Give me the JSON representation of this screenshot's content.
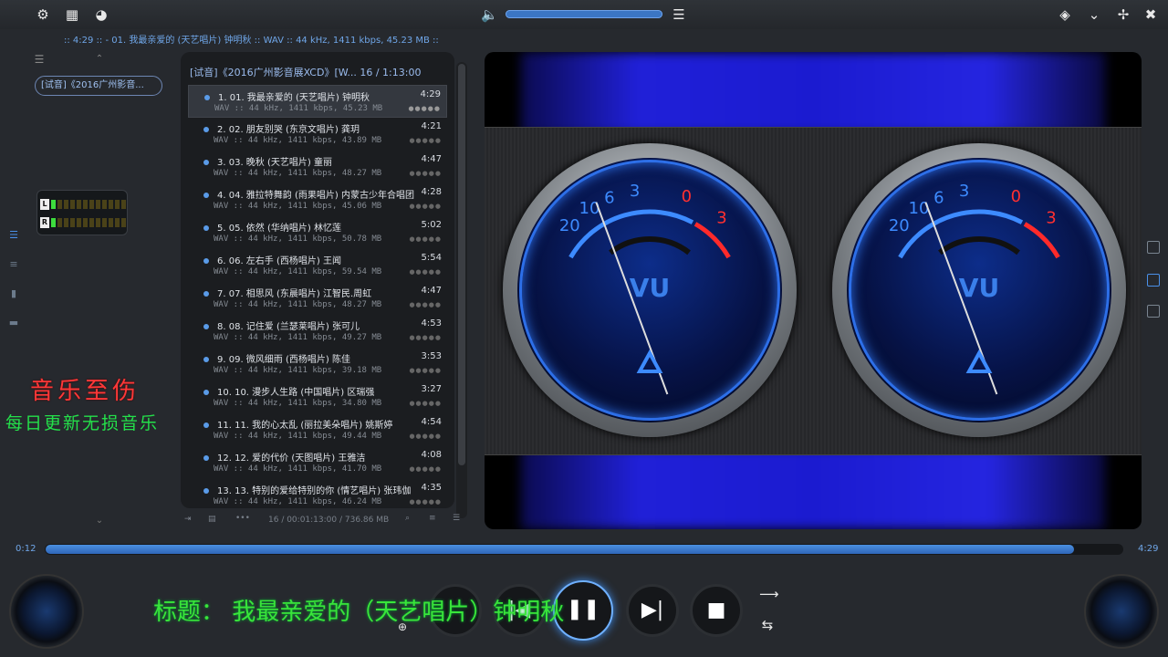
{
  "toolbar": {
    "settings_icon": "gear-icon",
    "layout_icon": "grid-icon",
    "theme_icon": "palette-icon",
    "volume_icon": "speaker-icon",
    "eq_icon": "sliders-icon",
    "volume_level": 0.98
  },
  "window": {
    "pin": "◈",
    "minimize": "⌄",
    "restore": "⌃",
    "close": "✖"
  },
  "nowplaying_line": ":: 4:29 :: - 01. 我最亲爱的 (天艺唱片) 钟明秋 :: WAV :: 44 kHz, 1411 kbps, 45.23 MB ::",
  "left": {
    "album_tag": "[试音]《2016广州影音...",
    "channel_l": "L",
    "channel_r": "R",
    "brand_title": "音乐至伤",
    "brand_sub": "每日更新无损音乐"
  },
  "playlist": {
    "header": "[试音]《2016广州影音展XCD》[W... 16 / 1:13:00",
    "tracks": [
      {
        "title": "1. 01. 我最亲爱的 (天艺唱片) 钟明秋",
        "dur": "4:29",
        "meta": "WAV :: 44 kHz, 1411 kbps, 45.23 MB"
      },
      {
        "title": "2. 02. 朋友别哭 (东京文唱片) 龚玥",
        "dur": "4:21",
        "meta": "WAV :: 44 kHz, 1411 kbps, 43.89 MB"
      },
      {
        "title": "3. 03. 晚秋 (天艺唱片) 童丽",
        "dur": "4:47",
        "meta": "WAV :: 44 kHz, 1411 kbps, 48.27 MB"
      },
      {
        "title": "4. 04. 雅拉特舞韵 (雨果唱片) 内蒙古少年合唱团",
        "dur": "4:28",
        "meta": "WAV :: 44 kHz, 1411 kbps, 45.06 MB"
      },
      {
        "title": "5. 05. 依然 (华纳唱片) 林忆莲",
        "dur": "5:02",
        "meta": "WAV :: 44 kHz, 1411 kbps, 50.78 MB"
      },
      {
        "title": "6. 06. 左右手 (西杨唱片) 王闻",
        "dur": "5:54",
        "meta": "WAV :: 44 kHz, 1411 kbps, 59.54 MB"
      },
      {
        "title": "7. 07. 相思风 (东晨唱片) 江智民.周虹",
        "dur": "4:47",
        "meta": "WAV :: 44 kHz, 1411 kbps, 48.27 MB"
      },
      {
        "title": "8. 08. 记住爱 (兰瑟莱唱片) 张可儿",
        "dur": "4:53",
        "meta": "WAV :: 44 kHz, 1411 kbps, 49.27 MB"
      },
      {
        "title": "9. 09. 微风细雨 (西杨唱片) 陈佳",
        "dur": "3:53",
        "meta": "WAV :: 44 kHz, 1411 kbps, 39.18 MB"
      },
      {
        "title": "10. 10. 漫步人生路 (中国唱片) 区瑞强",
        "dur": "3:27",
        "meta": "WAV :: 44 kHz, 1411 kbps, 34.80 MB"
      },
      {
        "title": "11. 11. 我的心太乱 (丽拉美朵唱片) 姚斯婷",
        "dur": "4:54",
        "meta": "WAV :: 44 kHz, 1411 kbps, 49.44 MB"
      },
      {
        "title": "12. 12. 爱的代价 (天图唱片) 王雅洁",
        "dur": "4:08",
        "meta": "WAV :: 44 kHz, 1411 kbps, 41.70 MB"
      },
      {
        "title": "13. 13. 特别的爱给特别的你 (情艺唱片) 张玮伽",
        "dur": "4:35",
        "meta": "WAV :: 44 kHz, 1411 kbps, 46.24 MB"
      }
    ],
    "footer_info": "16 / 00:01:13:00 / 736.86 MB"
  },
  "meters": {
    "label": "VU",
    "scale": [
      "20",
      "10",
      "6",
      "3",
      "0",
      "3"
    ]
  },
  "transport": {
    "elapsed": "0:12",
    "total": "4:29",
    "progress": 0.955,
    "subtitle": "标题： 我最亲爱的（天艺唱片）钟明秋",
    "next_glyph": "▶|",
    "stop_glyph": "■",
    "play_glyph": "❚❚",
    "prev_glyph": "|◀"
  }
}
